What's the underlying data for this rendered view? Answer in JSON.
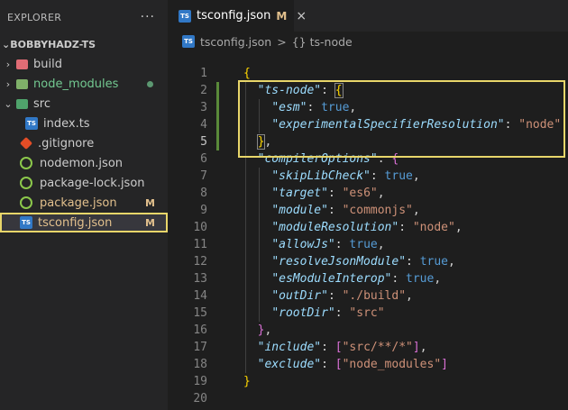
{
  "sidebar": {
    "header": "EXPLORER",
    "more": "···",
    "project": "BOBBYHADZ-TS",
    "items": [
      {
        "label": "build",
        "kind": "folder",
        "expanded": false,
        "color": "#cccccc"
      },
      {
        "label": "node_modules",
        "kind": "folder",
        "expanded": false,
        "color": "#73c991",
        "dot": true
      },
      {
        "label": "src",
        "kind": "folder",
        "expanded": true,
        "color": "#cccccc"
      },
      {
        "label": "index.ts",
        "kind": "ts",
        "indent": true,
        "color": "#cccccc"
      },
      {
        "label": ".gitignore",
        "kind": "git",
        "color": "#cccccc"
      },
      {
        "label": "nodemon.json",
        "kind": "node",
        "color": "#cccccc"
      },
      {
        "label": "package-lock.json",
        "kind": "node",
        "color": "#cccccc"
      },
      {
        "label": "package.json",
        "kind": "node",
        "color": "#e2c08d",
        "badge": "M"
      },
      {
        "label": "tsconfig.json",
        "kind": "ts",
        "color": "#e2c08d",
        "badge": "M",
        "selected": true
      }
    ]
  },
  "tab": {
    "icon": "TS",
    "label": "tsconfig.json",
    "modified": "M",
    "close": "×"
  },
  "breadcrumb": {
    "file": "tsconfig.json",
    "sep": ">",
    "symbol_icon": "{}",
    "symbol": "ts-node"
  },
  "code_lines": [
    {
      "n": "1"
    },
    {
      "n": "2"
    },
    {
      "n": "3"
    },
    {
      "n": "4"
    },
    {
      "n": "5"
    },
    {
      "n": "6"
    },
    {
      "n": "7"
    },
    {
      "n": "8"
    },
    {
      "n": "9"
    },
    {
      "n": "10"
    },
    {
      "n": "11"
    },
    {
      "n": "12"
    },
    {
      "n": "13"
    },
    {
      "n": "14"
    },
    {
      "n": "15"
    },
    {
      "n": "16"
    },
    {
      "n": "17"
    },
    {
      "n": "18"
    },
    {
      "n": "19"
    },
    {
      "n": "20"
    }
  ],
  "code": {
    "ts_node_key": "\"ts-node\"",
    "esm_key": "\"esm\"",
    "esm_val": "true",
    "esr_key": "\"experimentalSpecifierResolution\"",
    "esr_val": "\"node\"",
    "compiler_key": "\"compilerOptions\"",
    "skip_key": "\"skipLibCheck\"",
    "skip_val": "true",
    "target_key": "\"target\"",
    "target_val": "\"es6\"",
    "module_key": "\"module\"",
    "module_val": "\"commonjs\"",
    "modres_key": "\"moduleResolution\"",
    "modres_val": "\"node\"",
    "allowjs_key": "\"allowJs\"",
    "allowjs_val": "true",
    "rjm_key": "\"resolveJsonModule\"",
    "rjm_val": "true",
    "esmi_key": "\"esModuleInterop\"",
    "esmi_val": "true",
    "outdir_key": "\"outDir\"",
    "outdir_val": "\"./build\"",
    "rootdir_key": "\"rootDir\"",
    "rootdir_val": "\"src\"",
    "include_key": "\"include\"",
    "include_val": "\"src/**/*\"",
    "exclude_key": "\"exclude\"",
    "exclude_val": "\"node_modules\""
  }
}
